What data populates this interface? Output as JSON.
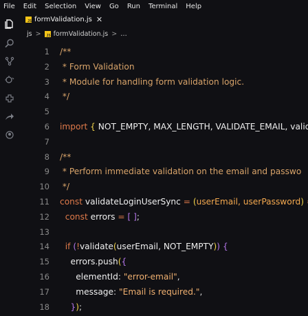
{
  "menu": [
    "File",
    "Edit",
    "Selection",
    "View",
    "Go",
    "Run",
    "Terminal",
    "Help"
  ],
  "activity": [
    "files-icon",
    "search-icon",
    "source-control-icon",
    "debug-icon",
    "extensions-icon",
    "remote-icon",
    "account-icon"
  ],
  "tab": {
    "filename": "formValidation.js",
    "close": "✕"
  },
  "breadcrumb": {
    "folder": "js",
    "file": "formValidation.js",
    "more": "…"
  },
  "lines": [
    {
      "n": "1",
      "tokens": [
        [
          "cm",
          "/**"
        ]
      ]
    },
    {
      "n": "2",
      "tokens": [
        [
          "cm",
          " * Form Validation"
        ]
      ]
    },
    {
      "n": "3",
      "tokens": [
        [
          "cm",
          " * Module for handling form validation logic."
        ]
      ]
    },
    {
      "n": "4",
      "tokens": [
        [
          "cm",
          " */"
        ]
      ]
    },
    {
      "n": "5",
      "tokens": []
    },
    {
      "n": "6",
      "tokens": [
        [
          "kw",
          "import "
        ],
        [
          "br",
          "{ "
        ],
        [
          "id",
          "NOT_EMPTY, MAX_LENGTH, VALIDATE_EMAIL, validat"
        ]
      ]
    },
    {
      "n": "7",
      "tokens": []
    },
    {
      "n": "8",
      "tokens": [
        [
          "cm",
          "/**"
        ]
      ]
    },
    {
      "n": "9",
      "tokens": [
        [
          "cm",
          " * Perform immediate validation on the email and passwo"
        ]
      ]
    },
    {
      "n": "10",
      "tokens": [
        [
          "cm",
          " */"
        ]
      ]
    },
    {
      "n": "11",
      "tokens": [
        [
          "kw",
          "const "
        ],
        [
          "fn",
          "validateLoginUserSync"
        ],
        [
          "op",
          " = "
        ],
        [
          "br",
          "("
        ],
        [
          "param",
          "userEmail, userPassword"
        ],
        [
          "br",
          ")"
        ],
        [
          "op",
          " ="
        ]
      ]
    },
    {
      "n": "12",
      "tokens": [
        [
          "kw",
          "  const "
        ],
        [
          "id",
          "errors"
        ],
        [
          "op",
          " = "
        ],
        [
          "br2",
          "[ ]"
        ],
        [
          "punc",
          ";"
        ]
      ]
    },
    {
      "n": "13",
      "tokens": []
    },
    {
      "n": "14",
      "tokens": [
        [
          "kw",
          "  if "
        ],
        [
          "br2",
          "("
        ],
        [
          "op",
          "!"
        ],
        [
          "fn",
          "validate"
        ],
        [
          "br",
          "("
        ],
        [
          "id",
          "userEmail, NOT_EMPTY"
        ],
        [
          "br",
          ")"
        ],
        [
          "br2",
          ")"
        ],
        [
          "punc",
          " "
        ],
        [
          "br2",
          "{"
        ]
      ]
    },
    {
      "n": "15",
      "tokens": [
        [
          "id",
          "    errors"
        ],
        [
          "punc",
          "."
        ],
        [
          "fn",
          "push"
        ],
        [
          "br",
          "("
        ],
        [
          "br2",
          "{"
        ]
      ]
    },
    {
      "n": "16",
      "tokens": [
        [
          "id",
          "      elementId"
        ],
        [
          "punc",
          ": "
        ],
        [
          "str",
          "\"error-email\""
        ],
        [
          "punc",
          ","
        ]
      ]
    },
    {
      "n": "17",
      "tokens": [
        [
          "id",
          "      message"
        ],
        [
          "punc",
          ": "
        ],
        [
          "str",
          "\"Email is required.\""
        ],
        [
          "punc",
          ","
        ]
      ]
    },
    {
      "n": "18",
      "tokens": [
        [
          "br2",
          "    }"
        ],
        [
          "br",
          ")"
        ],
        [
          "punc",
          ";"
        ]
      ]
    }
  ]
}
